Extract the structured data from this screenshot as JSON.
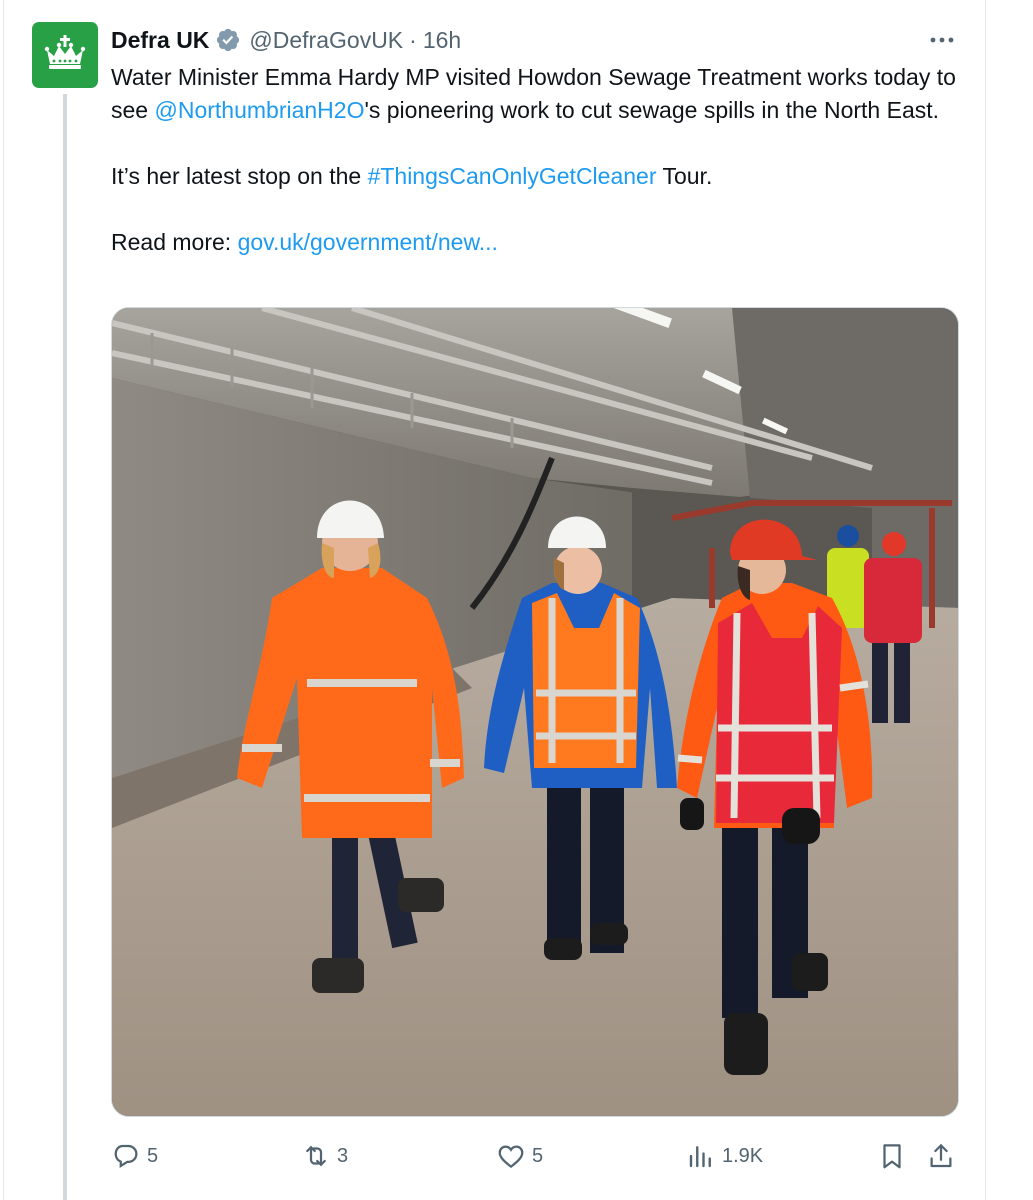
{
  "tweet": {
    "author": {
      "display_name": "Defra UK",
      "handle": "@DefraGovUK",
      "separator": "·",
      "time": "16h",
      "avatar_icon": "crown-logo-icon",
      "avatar_color": "#28a146",
      "verified_icon": "verified-badge-icon",
      "verified_color": "#829aab"
    },
    "text": {
      "line1_a": "Water Minister Emma Hardy MP visited Howdon Sewage Treatment works today to see ",
      "mention": "@NorthumbrianH2O",
      "line1_b": "'s pioneering work to cut sewage spills in the North East.",
      "line2_a": "It’s her latest stop on the ",
      "hashtag": "#ThingsCanOnlyGetCleaner",
      "line2_b": " Tour.",
      "line3_a": "Read more: ",
      "url": "gov.uk/government/new..."
    },
    "link_color": "#1d9bf0",
    "media": {
      "icon": "photo-tunnel-workers-image"
    },
    "actions": {
      "replies": "5",
      "reposts": "3",
      "likes": "5",
      "views": "1.9K",
      "reply_icon": "reply-icon",
      "repost_icon": "repost-icon",
      "like_icon": "heart-icon",
      "views_icon": "views-chart-icon",
      "bookmark_icon": "bookmark-icon",
      "share_icon": "share-icon"
    }
  }
}
